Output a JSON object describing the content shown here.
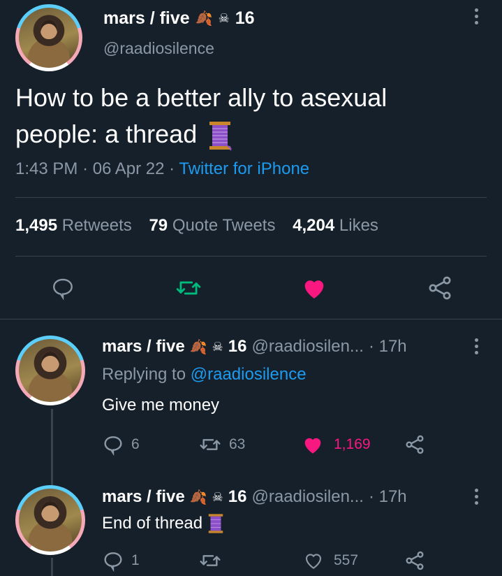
{
  "main_tweet": {
    "display_name": "mars / five",
    "name_suffix": "16",
    "handle": "@raadiosilence",
    "text": "How to be a better ally to asexual people: a thread",
    "time": "1:43 PM",
    "date": "06 Apr 22",
    "sep": "·",
    "client": "Twitter for iPhone",
    "stats": {
      "retweets_count": "1,495",
      "retweets_label": "Retweets",
      "quotes_count": "79",
      "quotes_label": "Quote Tweets",
      "likes_count": "4,204",
      "likes_label": "Likes"
    }
  },
  "replies": [
    {
      "display_name": "mars / five",
      "name_suffix": "16",
      "handle": "@raadiosilen...",
      "time": "· 17h",
      "replying_prefix": "Replying to",
      "replying_to": "@raadiosilence",
      "text": "Give me money",
      "reply_count": "6",
      "retweet_count": "63",
      "like_count": "1,169"
    },
    {
      "display_name": "mars / five",
      "name_suffix": "16",
      "handle": "@raadiosilen...",
      "time": "· 17h",
      "text": "End of thread",
      "reply_count": "1",
      "retweet_count": "",
      "like_count": "557"
    }
  ],
  "colors": {
    "background": "#15202b",
    "accent": "#1d9bf0",
    "like": "#f91880",
    "retweet": "#00ba7c",
    "muted": "#8b98a5"
  },
  "icons": [
    "reply-icon",
    "retweet-icon",
    "like-icon",
    "share-icon",
    "more-icon",
    "spool-emoji",
    "leaf-emoji",
    "skull-emoji"
  ]
}
